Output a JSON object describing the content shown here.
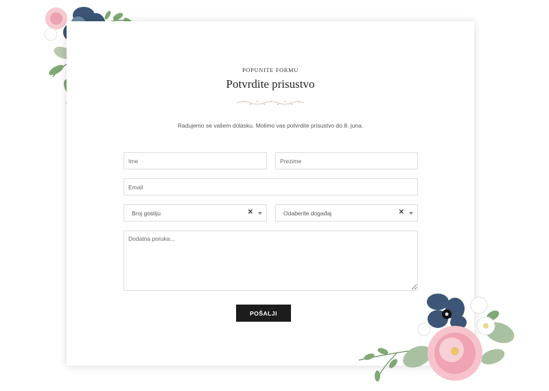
{
  "header": {
    "eyebrow": "POPUNITE FORMU",
    "title": "Potvrdite prisustvo",
    "intro": "Radujemo se vašem dolasku. Molimo vas potvrdite prisustvo do 8. juna."
  },
  "form": {
    "first_name_placeholder": "Ime",
    "last_name_placeholder": "Prezime",
    "email_placeholder": "Email",
    "guests_select": "Broj gostiju",
    "event_select": "Odaberite događaj",
    "clear_glyph": "✕",
    "message_placeholder": "Dodatna poruka...",
    "submit_label": "POŠALJI"
  },
  "colors": {
    "button_bg": "#1c1c1c",
    "flower_blue": "#3d5576",
    "flower_pink": "#f2a6b4",
    "leaf_green": "#6f9a62"
  }
}
